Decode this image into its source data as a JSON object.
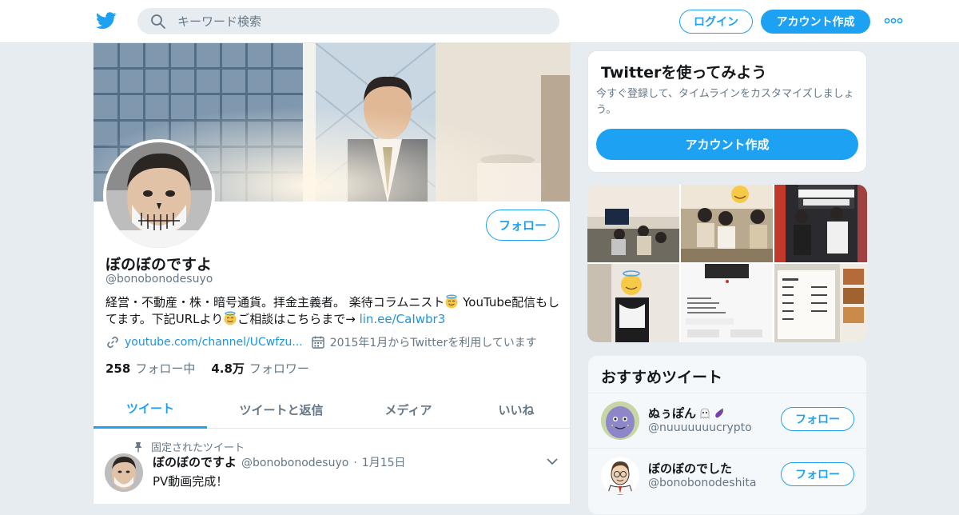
{
  "topbar": {
    "logo_icon": "twitter-bird-icon",
    "search_placeholder": "キーワード検索",
    "login_label": "ログイン",
    "signup_label": "アカウント作成",
    "more_icon": "more-dots-icon",
    "accent": "#1da1f2"
  },
  "profile": {
    "follow_label": "フォロー",
    "display_name": "ぼのぼのですよ",
    "handle": "@bonobonodesuyo",
    "bio_part1": "経営・不動産・株・暗号通貨。拝金主義者。 楽待コラムニスト",
    "bio_part2": " YouTube配信もしてます。下記URLより",
    "bio_part3": "ご相談はこちらまで→ ",
    "bio_link": "lin.ee/CaIwbr3",
    "website": "youtube.com/channel/UCwfzu...",
    "joined": "2015年1月からTwitterを利用しています",
    "following_count": "258",
    "following_label": "フォロー中",
    "followers_count": "4.8万",
    "followers_label": "フォロワー"
  },
  "tabs": [
    {
      "label": "ツイート",
      "active": true
    },
    {
      "label": "ツイートと返信",
      "active": false
    },
    {
      "label": "メディア",
      "active": false
    },
    {
      "label": "いいね",
      "active": false
    }
  ],
  "pinned_tweet": {
    "pinned_label": "固定されたツイート",
    "name": "ぼのぼのですよ",
    "handle": "@bonobonodesuyo",
    "separator": "·",
    "date": "1月15日",
    "text": "PV動画完成！"
  },
  "signup_card": {
    "title": "Twitterを使ってみよう",
    "description": "今すぐ登録して、タイムラインをカスタマイズしましょう。",
    "button_label": "アカウント作成"
  },
  "recommended": {
    "title": "おすすめツイート",
    "users": [
      {
        "name": "ぬぅぽん",
        "handle": "@nuuuuuuucrypto",
        "button": "フォロー"
      },
      {
        "name": "ぼのぼのでした",
        "handle": "@bonobonodeshita",
        "button": "フォロー"
      }
    ]
  }
}
